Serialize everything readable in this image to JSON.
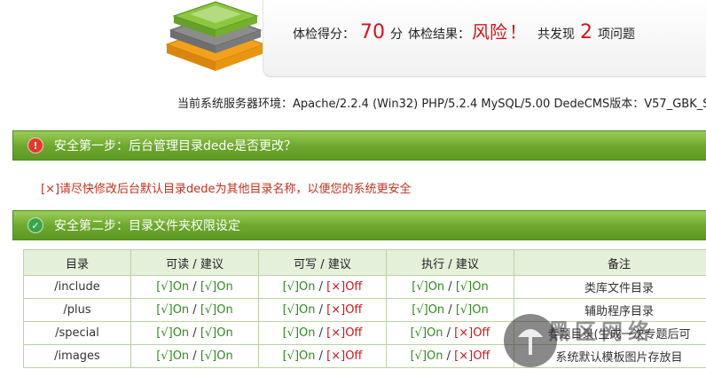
{
  "score": {
    "score_label": "体检得分：",
    "score_value": "70",
    "score_unit": "分",
    "result_label": "体检结果：",
    "result_value": "风险",
    "result_mark": "！",
    "found_label": "共发现",
    "found_count": "2",
    "found_unit": "项问题"
  },
  "env_line": "当前系统服务器环境：Apache/2.2.4 (Win32) PHP/5.2.4 MySQL/5.00   DedeCMS版本：V57_GBK_S",
  "step1": {
    "title": "安全第一步：后台管理目录dede是否更改？"
  },
  "warning": "[×]请尽快修改后台默认目录dede为其他目录名称，以便您的系统更安全",
  "step2": {
    "title": "安全第二步：目录文件夹权限设定"
  },
  "table": {
    "headers": [
      "目录",
      "可读 / 建议",
      "可写 / 建议",
      "执行 / 建议",
      "备注"
    ],
    "rows": [
      {
        "dir": "/include",
        "read": [
          "[√]On",
          "[√]On"
        ],
        "write": [
          "[√]On",
          "[×]Off"
        ],
        "exec": [
          "[√]On",
          "[√]On"
        ],
        "note": "类库文件目录"
      },
      {
        "dir": "/plus",
        "read": [
          "[√]On",
          "[√]On"
        ],
        "write": [
          "[√]On",
          "[×]Off"
        ],
        "exec": [
          "[√]On",
          "[√]On"
        ],
        "note": "辅助程序目录"
      },
      {
        "dir": "/special",
        "read": [
          "[√]On",
          "[√]On"
        ],
        "write": [
          "[√]On",
          "[×]Off"
        ],
        "exec": [
          "[√]On",
          "[×]Off"
        ],
        "note": "专题目录(生成一次专题后可"
      },
      {
        "dir": "/images",
        "read": [
          "[√]On",
          "[√]On"
        ],
        "write": [
          "[√]On",
          "[×]Off"
        ],
        "exec": [
          "[√]On",
          "[×]Off"
        ],
        "note": "系统默认模板图片存放目"
      }
    ]
  },
  "watermark": {
    "text": "黑区网络"
  },
  "colors": {
    "accent_green": "#6fa92f",
    "danger_red": "#d4141c",
    "ok_green": "#2f8a1d"
  }
}
